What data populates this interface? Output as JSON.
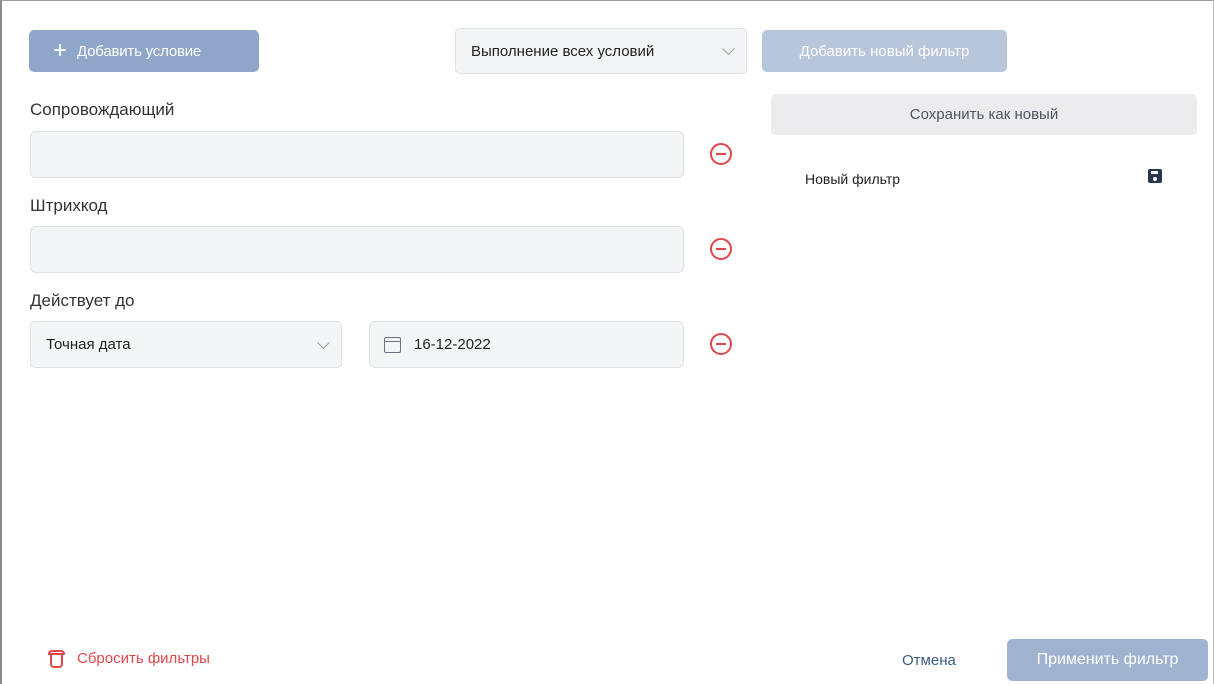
{
  "toolbar": {
    "add_condition_label": "Добавить условие",
    "match_mode_value": "Выполнение всех условий",
    "add_new_filter_label": "Добавить новый фильтр"
  },
  "conditions": [
    {
      "label": "Сопровождающий",
      "value": ""
    },
    {
      "label": "Штрихкод",
      "value": ""
    },
    {
      "label": "Действует до",
      "mode_value": "Точная дата",
      "date_value": "16-12-2022"
    }
  ],
  "saved_filters": {
    "save_as_new_label": "Сохранить как новый",
    "items": [
      {
        "name": "Новый фильтр"
      }
    ]
  },
  "footer": {
    "reset_label": "Сбросить фильтры",
    "cancel_label": "Отмена",
    "apply_label": "Применить фильтр"
  },
  "colors": {
    "primary_button": "#8fa6c9",
    "disabled_button": "#b8c6db",
    "danger": "#e0464a",
    "link": "#3f5a85",
    "input_bg": "#f4f5f7"
  },
  "icons": [
    "plus-icon",
    "chevron-down-icon",
    "remove-circle-icon",
    "calendar-icon",
    "save-disk-icon",
    "trash-icon"
  ]
}
